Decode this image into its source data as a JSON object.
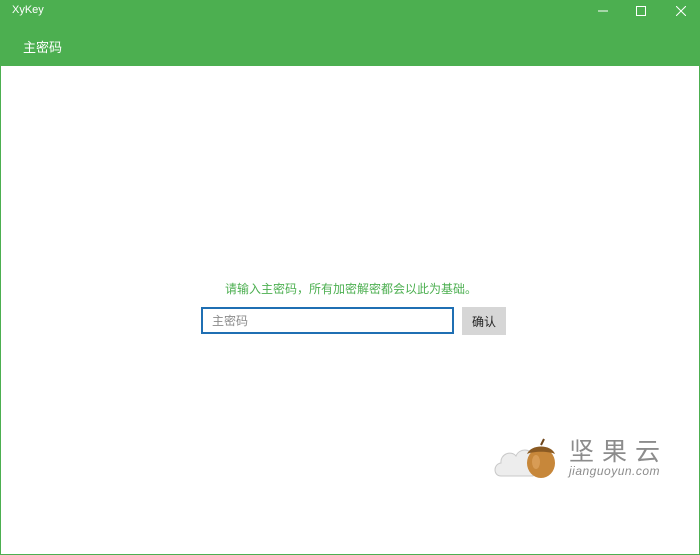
{
  "window": {
    "title": "XyKey"
  },
  "header": {
    "page_title": "主密码"
  },
  "main": {
    "prompt": "请输入主密码，所有加密解密都会以此为基础。",
    "password_input": {
      "placeholder": "主密码",
      "value": ""
    },
    "confirm_label": "确认"
  },
  "watermark": {
    "text": "坚果云",
    "subtext": "jianguoyun.com"
  },
  "colors": {
    "brand_green": "#4caf50",
    "input_border": "#1f6fb3",
    "button_bg": "#d6d6d6"
  }
}
